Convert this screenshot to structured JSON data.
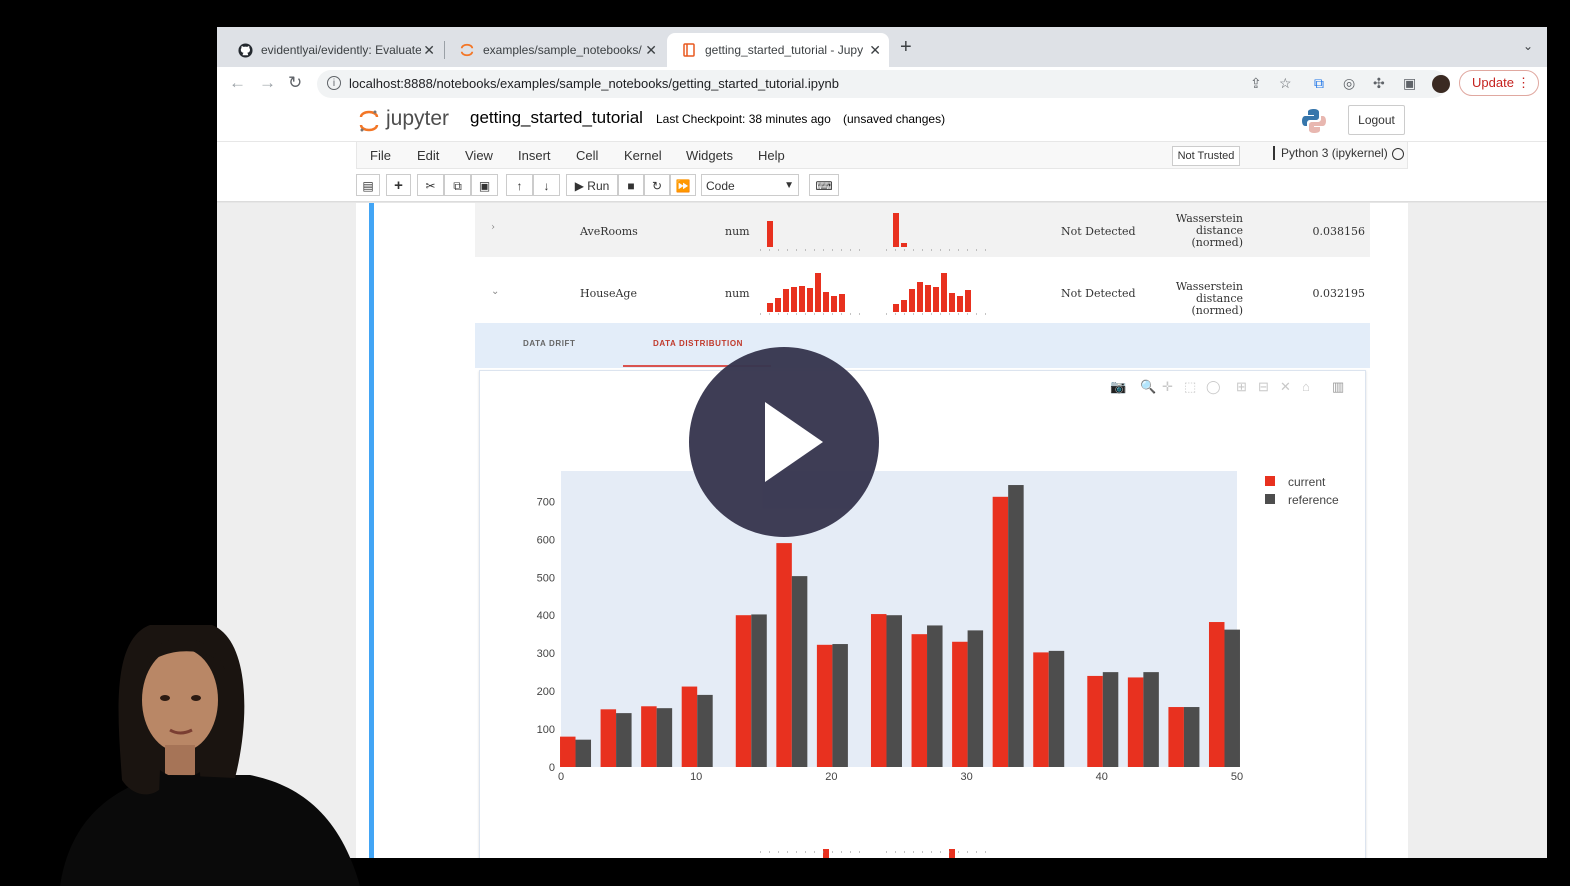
{
  "browser": {
    "tabs": [
      {
        "title": "evidentlyai/evidently: Evaluate",
        "icon": "github-icon",
        "active": false
      },
      {
        "title": "examples/sample_notebooks/",
        "icon": "jupyter-icon",
        "active": false
      },
      {
        "title": "getting_started_tutorial - Jupy",
        "icon": "notebook-icon",
        "active": true
      }
    ],
    "url": "localhost:8888/notebooks/examples/sample_notebooks/getting_started_tutorial.ipynb",
    "update_label": "Update"
  },
  "jupyter": {
    "logo_text": "jupyter",
    "notebook_name": "getting_started_tutorial",
    "checkpoint": "Last Checkpoint: 38 minutes ago",
    "unsaved": "(unsaved changes)",
    "logout_label": "Logout",
    "menu": [
      "File",
      "Edit",
      "View",
      "Insert",
      "Cell",
      "Kernel",
      "Widgets",
      "Help"
    ],
    "trusted_label": "Not Trusted",
    "kernel_label": "Python 3 (ipykernel)",
    "run_label": "Run",
    "cell_type": "Code"
  },
  "feature_rows": [
    {
      "name": "AveRooms",
      "type": "num",
      "drift": "Not Detected",
      "stat_line1": "Wasserstein distance",
      "stat_line2": "(normed)",
      "score": "0.038156"
    },
    {
      "name": "HouseAge",
      "type": "num",
      "drift": "Not Detected",
      "stat_line1": "Wasserstein distance",
      "stat_line2": "(normed)",
      "score": "0.032195"
    }
  ],
  "output_tabs": {
    "drift": "DATA DRIFT",
    "distribution": "DATA DISTRIBUTION"
  },
  "colors": {
    "current": "#e8311f",
    "reference": "#4d4d4d",
    "plot_bg": "#e5ecf6",
    "accent": "#42a5f5"
  },
  "chart_data": {
    "type": "bar",
    "x": [
      1,
      4,
      7,
      10,
      14,
      17,
      20,
      24,
      27,
      30,
      33,
      36,
      40,
      43,
      46,
      49
    ],
    "series": [
      {
        "name": "current",
        "values": [
          80,
          152,
          160,
          212,
          400,
          590,
          322,
          403,
          350,
          330,
          712,
          302,
          240,
          236,
          158,
          382
        ]
      },
      {
        "name": "reference",
        "values": [
          72,
          142,
          155,
          190,
          402,
          503,
          324,
          400,
          373,
          360,
          743,
          306,
          250,
          250,
          158,
          362
        ]
      }
    ],
    "xlim": [
      0,
      50
    ],
    "ylim": [
      0,
      780
    ],
    "xticks": [
      0,
      10,
      20,
      30,
      40,
      50
    ],
    "yticks": [
      0,
      100,
      200,
      300,
      400,
      500,
      600,
      700
    ],
    "legend_position": "top-right",
    "grid": false
  }
}
